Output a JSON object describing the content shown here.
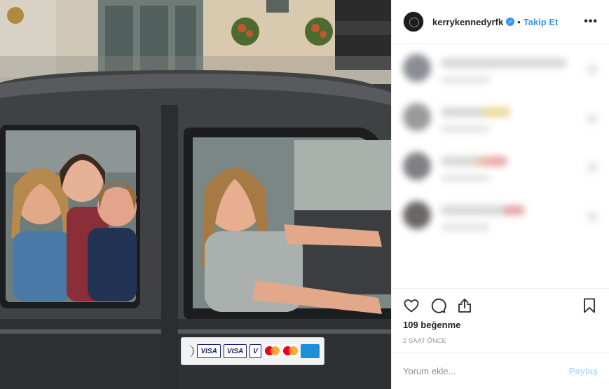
{
  "header": {
    "username": "kerrykennedyrfk",
    "separator": "•",
    "follow_label": "Takip Et",
    "more_label": "•••",
    "verified_glyph": "✓"
  },
  "photo": {
    "icons": {
      "sticker_contactless": "contactless-icon"
    },
    "sticker_cards": [
      "VISA",
      "VISA",
      "V"
    ]
  },
  "comments": {
    "blurred": true,
    "count": 4
  },
  "actions": {
    "icons": [
      "heart-icon",
      "comment-icon",
      "share-icon",
      "bookmark-icon"
    ],
    "likes_text": "109 beğenme",
    "time_text": "2 SAAT ÖNCE"
  },
  "comment_box": {
    "placeholder": "Yorum ekle...",
    "submit_label": "Paylaş"
  },
  "colors": {
    "link_blue": "#3897f0",
    "disabled_blue": "#b3dbff",
    "text": "#262626",
    "muted": "#8e8e8e"
  }
}
